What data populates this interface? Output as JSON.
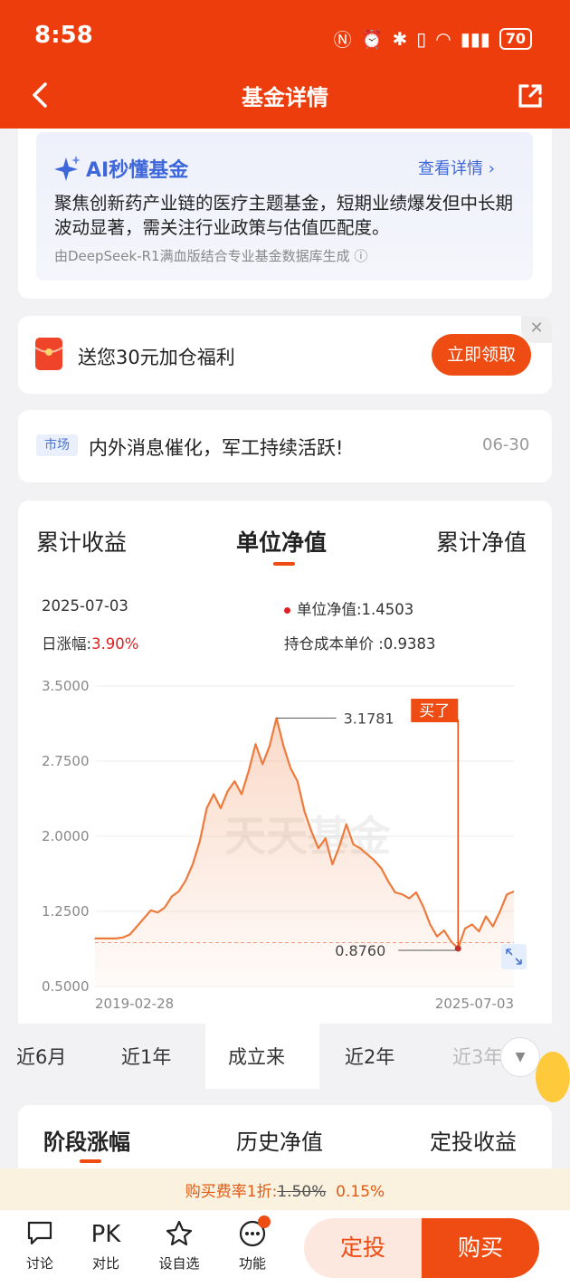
{
  "status": {
    "time": "8:58",
    "battery": "70"
  },
  "nav": {
    "title": "基金详情"
  },
  "ai": {
    "title": "AI秒懂基金",
    "link": "查看详情",
    "text": "聚焦创新药产业链的医疗主题基金，短期业绩爆发但中长期波动显著，需关注行业政策与估值匹配度。",
    "source": "由DeepSeek-R1满血版结合专业基金数据库生成"
  },
  "promo": {
    "text": "送您30元加仓福利",
    "button": "立即领取"
  },
  "news": {
    "tag": "市场",
    "text": "内外消息催化，军工持续活跃!",
    "date": "06-30"
  },
  "chart_tabs": [
    "累计收益",
    "单位净值",
    "累计净值"
  ],
  "info": {
    "date": "2025-07-03",
    "nav_label": "单位净值:1.4503",
    "change_label": "日涨幅:",
    "change_value": "3.90%",
    "cost_label": "持仓成本单价 :0.9383"
  },
  "chart_data": {
    "type": "line",
    "title": "",
    "xlabel": "",
    "ylabel": "",
    "y_ticks": [
      "3.5000",
      "2.7500",
      "2.0000",
      "1.2500",
      "0.5000"
    ],
    "ylim": [
      0.5,
      3.5
    ],
    "x_labels": [
      "2019-02-28",
      "2025-07-03"
    ],
    "watermark": "天天基金",
    "annotations": {
      "max": "3.1781",
      "min": "0.8760",
      "buy": "买了"
    },
    "cost_line": 0.9383,
    "series": [
      {
        "name": "",
        "values": [
          0.98,
          0.98,
          0.98,
          0.98,
          0.99,
          1.02,
          1.1,
          1.18,
          1.26,
          1.24,
          1.29,
          1.4,
          1.45,
          1.56,
          1.72,
          1.95,
          2.28,
          2.42,
          2.28,
          2.45,
          2.55,
          2.42,
          2.65,
          2.92,
          2.72,
          2.9,
          3.18,
          2.9,
          2.68,
          2.55,
          2.25,
          2.05,
          1.88,
          1.98,
          1.72,
          1.9,
          2.12,
          1.92,
          1.88,
          1.82,
          1.76,
          1.68,
          1.55,
          1.44,
          1.42,
          1.38,
          1.44,
          1.3,
          1.12,
          1.0,
          1.06,
          0.95,
          0.88,
          1.08,
          1.12,
          1.05,
          1.2,
          1.1,
          1.25,
          1.42,
          1.45
        ]
      }
    ]
  },
  "ranges": [
    "近6月",
    "近1年",
    "成立来",
    "近2年",
    "近3年"
  ],
  "section_tabs": [
    "阶段涨幅",
    "历史净值",
    "定投收益"
  ],
  "fee": {
    "prefix": "购买费率1折:",
    "old": "1.50%",
    "new": "0.15%"
  },
  "bottom": {
    "items": [
      {
        "label": "讨论"
      },
      {
        "label": "对比",
        "icon_text": "PK"
      },
      {
        "label": "设自选"
      },
      {
        "label": "功能"
      }
    ],
    "fix_button": "定投",
    "buy_button": "购买"
  },
  "colors": {
    "brand": "#ee3d0c",
    "accent": "#ee4c12",
    "line": "#ee7a3c",
    "ai_blue": "#3e67d9"
  }
}
